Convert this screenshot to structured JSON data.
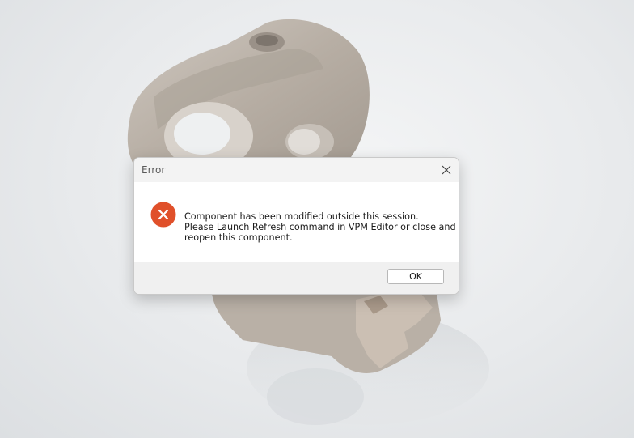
{
  "colors": {
    "error_red": "#e0502a",
    "dialog_bg": "#ffffff",
    "titlebar_bg": "#f3f3f3",
    "footer_bg": "#f0f0f0",
    "model_tone": "#bfb7ae"
  },
  "dialog": {
    "title": "Error",
    "close_icon": "close-icon",
    "status_icon": "error-circle-x-icon",
    "message_lines": [
      "Component has been modified outside this session.",
      "Please Launch Refresh command in VPM Editor or close and",
      "reopen this component."
    ],
    "ok_label": "OK"
  }
}
